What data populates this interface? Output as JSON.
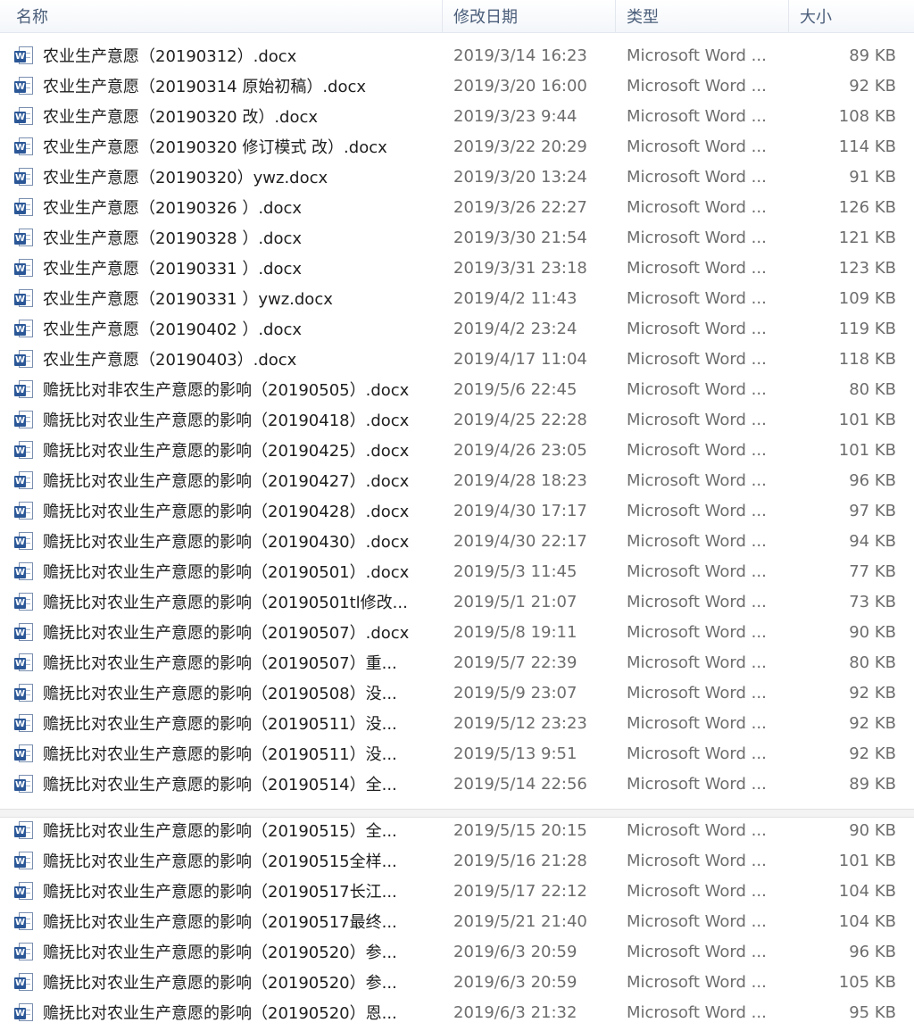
{
  "columns": {
    "name": "名称",
    "date": "修改日期",
    "type": "类型",
    "size": "大小"
  },
  "icon": "word-document-icon",
  "files": [
    {
      "name": "农业生产意愿（20190312）.docx",
      "date": "2019/3/14 16:23",
      "type": "Microsoft Word ...",
      "size": "89 KB"
    },
    {
      "name": "农业生产意愿（20190314 原始初稿）.docx",
      "date": "2019/3/20 16:00",
      "type": "Microsoft Word ...",
      "size": "92 KB"
    },
    {
      "name": "农业生产意愿（20190320 改）.docx",
      "date": "2019/3/23 9:44",
      "type": "Microsoft Word ...",
      "size": "108 KB"
    },
    {
      "name": "农业生产意愿（20190320 修订模式 改）.docx",
      "date": "2019/3/22 20:29",
      "type": "Microsoft Word ...",
      "size": "114 KB"
    },
    {
      "name": "农业生产意愿（20190320）ywz.docx",
      "date": "2019/3/20 13:24",
      "type": "Microsoft Word ...",
      "size": "91 KB"
    },
    {
      "name": "农业生产意愿（20190326 ）.docx",
      "date": "2019/3/26 22:27",
      "type": "Microsoft Word ...",
      "size": "126 KB"
    },
    {
      "name": "农业生产意愿（20190328 ）.docx",
      "date": "2019/3/30 21:54",
      "type": "Microsoft Word ...",
      "size": "121 KB"
    },
    {
      "name": "农业生产意愿（20190331 ）.docx",
      "date": "2019/3/31 23:18",
      "type": "Microsoft Word ...",
      "size": "123 KB"
    },
    {
      "name": "农业生产意愿（20190331 ）ywz.docx",
      "date": "2019/4/2 11:43",
      "type": "Microsoft Word ...",
      "size": "109 KB"
    },
    {
      "name": "农业生产意愿（20190402 ）.docx",
      "date": "2019/4/2 23:24",
      "type": "Microsoft Word ...",
      "size": "119 KB"
    },
    {
      "name": "农业生产意愿（20190403）.docx",
      "date": "2019/4/17 11:04",
      "type": "Microsoft Word ...",
      "size": "118 KB"
    },
    {
      "name": "赡抚比对非农生产意愿的影响（20190505）.docx",
      "date": "2019/5/6 22:45",
      "type": "Microsoft Word ...",
      "size": "80 KB"
    },
    {
      "name": "赡抚比对农业生产意愿的影响（20190418）.docx",
      "date": "2019/4/25 22:28",
      "type": "Microsoft Word ...",
      "size": "101 KB"
    },
    {
      "name": "赡抚比对农业生产意愿的影响（20190425）.docx",
      "date": "2019/4/26 23:05",
      "type": "Microsoft Word ...",
      "size": "101 KB"
    },
    {
      "name": "赡抚比对农业生产意愿的影响（20190427）.docx",
      "date": "2019/4/28 18:23",
      "type": "Microsoft Word ...",
      "size": "96 KB"
    },
    {
      "name": "赡抚比对农业生产意愿的影响（20190428）.docx",
      "date": "2019/4/30 17:17",
      "type": "Microsoft Word ...",
      "size": "97 KB"
    },
    {
      "name": "赡抚比对农业生产意愿的影响（20190430）.docx",
      "date": "2019/4/30 22:17",
      "type": "Microsoft Word ...",
      "size": "94 KB"
    },
    {
      "name": "赡抚比对农业生产意愿的影响（20190501）.docx",
      "date": "2019/5/3 11:45",
      "type": "Microsoft Word ...",
      "size": "77 KB"
    },
    {
      "name": "赡抚比对农业生产意愿的影响（20190501tl修改...",
      "date": "2019/5/1 21:07",
      "type": "Microsoft Word ...",
      "size": "73 KB"
    },
    {
      "name": "赡抚比对农业生产意愿的影响（20190507）.docx",
      "date": "2019/5/8 19:11",
      "type": "Microsoft Word ...",
      "size": "90 KB"
    },
    {
      "name": "赡抚比对农业生产意愿的影响（20190507）重...",
      "date": "2019/5/7 22:39",
      "type": "Microsoft Word ...",
      "size": "80 KB"
    },
    {
      "name": "赡抚比对农业生产意愿的影响（20190508）没...",
      "date": "2019/5/9 23:07",
      "type": "Microsoft Word ...",
      "size": "92 KB"
    },
    {
      "name": "赡抚比对农业生产意愿的影响（20190511）没...",
      "date": "2019/5/12 23:23",
      "type": "Microsoft Word ...",
      "size": "92 KB"
    },
    {
      "name": "赡抚比对农业生产意愿的影响（20190511）没...",
      "date": "2019/5/13 9:51",
      "type": "Microsoft Word ...",
      "size": "92 KB"
    },
    {
      "name": "赡抚比对农业生产意愿的影响（20190514）全...",
      "date": "2019/5/14 22:56",
      "type": "Microsoft Word ...",
      "size": "89 KB"
    }
  ],
  "files_continued": [
    {
      "name": "赡抚比对农业生产意愿的影响（20190515）全...",
      "date": "2019/5/15 20:15",
      "type": "Microsoft Word ...",
      "size": "90 KB"
    },
    {
      "name": "赡抚比对农业生产意愿的影响（20190515全样...",
      "date": "2019/5/16 21:28",
      "type": "Microsoft Word ...",
      "size": "101 KB"
    },
    {
      "name": "赡抚比对农业生产意愿的影响（20190517长江...",
      "date": "2019/5/17 22:12",
      "type": "Microsoft Word ...",
      "size": "104 KB"
    },
    {
      "name": "赡抚比对农业生产意愿的影响（20190517最终...",
      "date": "2019/5/21 21:40",
      "type": "Microsoft Word ...",
      "size": "104 KB"
    },
    {
      "name": "赡抚比对农业生产意愿的影响（20190520）参...",
      "date": "2019/6/3 20:59",
      "type": "Microsoft Word ...",
      "size": "96 KB"
    },
    {
      "name": "赡抚比对农业生产意愿的影响（20190520）参...",
      "date": "2019/6/3 20:59",
      "type": "Microsoft Word ...",
      "size": "105 KB"
    },
    {
      "name": "赡抚比对农业生产意愿的影响（20190520）恩...",
      "date": "2019/6/3 21:32",
      "type": "Microsoft Word ...",
      "size": "95 KB"
    }
  ]
}
